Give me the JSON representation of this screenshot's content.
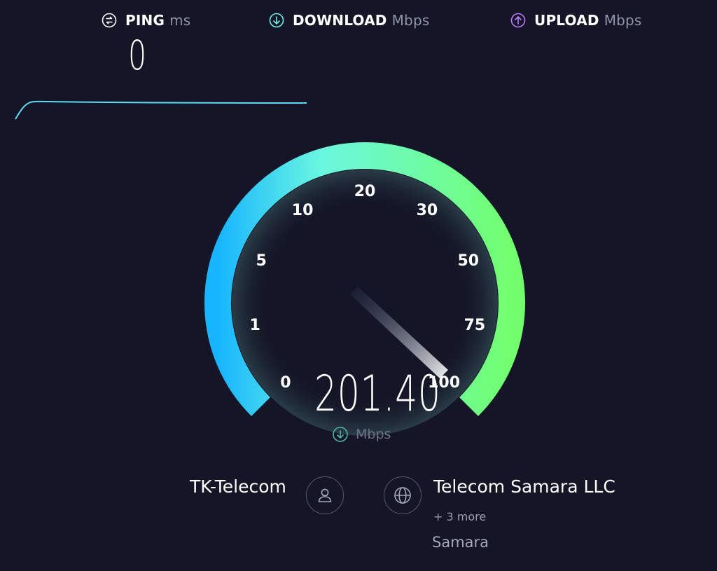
{
  "header": {
    "ping": {
      "label": "PING",
      "unit": "ms",
      "value": "0",
      "icon": "ping-icon"
    },
    "download": {
      "label": "DOWNLOAD",
      "unit": "Mbps",
      "icon": "download-arrow-icon"
    },
    "upload": {
      "label": "UPLOAD",
      "unit": "Mbps",
      "icon": "upload-arrow-icon"
    }
  },
  "gauge": {
    "ticks": [
      "0",
      "1",
      "5",
      "10",
      "20",
      "30",
      "50",
      "75",
      "100"
    ],
    "speed": "201.40",
    "unit": "Mbps",
    "needle_position_tick": "100",
    "colors": {
      "start": "#17b5ff",
      "mid": "#6af7e0",
      "end": "#72ff6e"
    }
  },
  "connection": {
    "isp": "TK-Telecom",
    "isp_icon": "user-icon",
    "server_icon": "globe-icon",
    "server": "Telecom Samara LLC",
    "more": "+ 3 more",
    "location": "Samara"
  },
  "colors": {
    "background": "#141526",
    "download_accent": "#6ff0e6",
    "upload_accent": "#c27bff",
    "graph_line": "#5fd9f0"
  }
}
